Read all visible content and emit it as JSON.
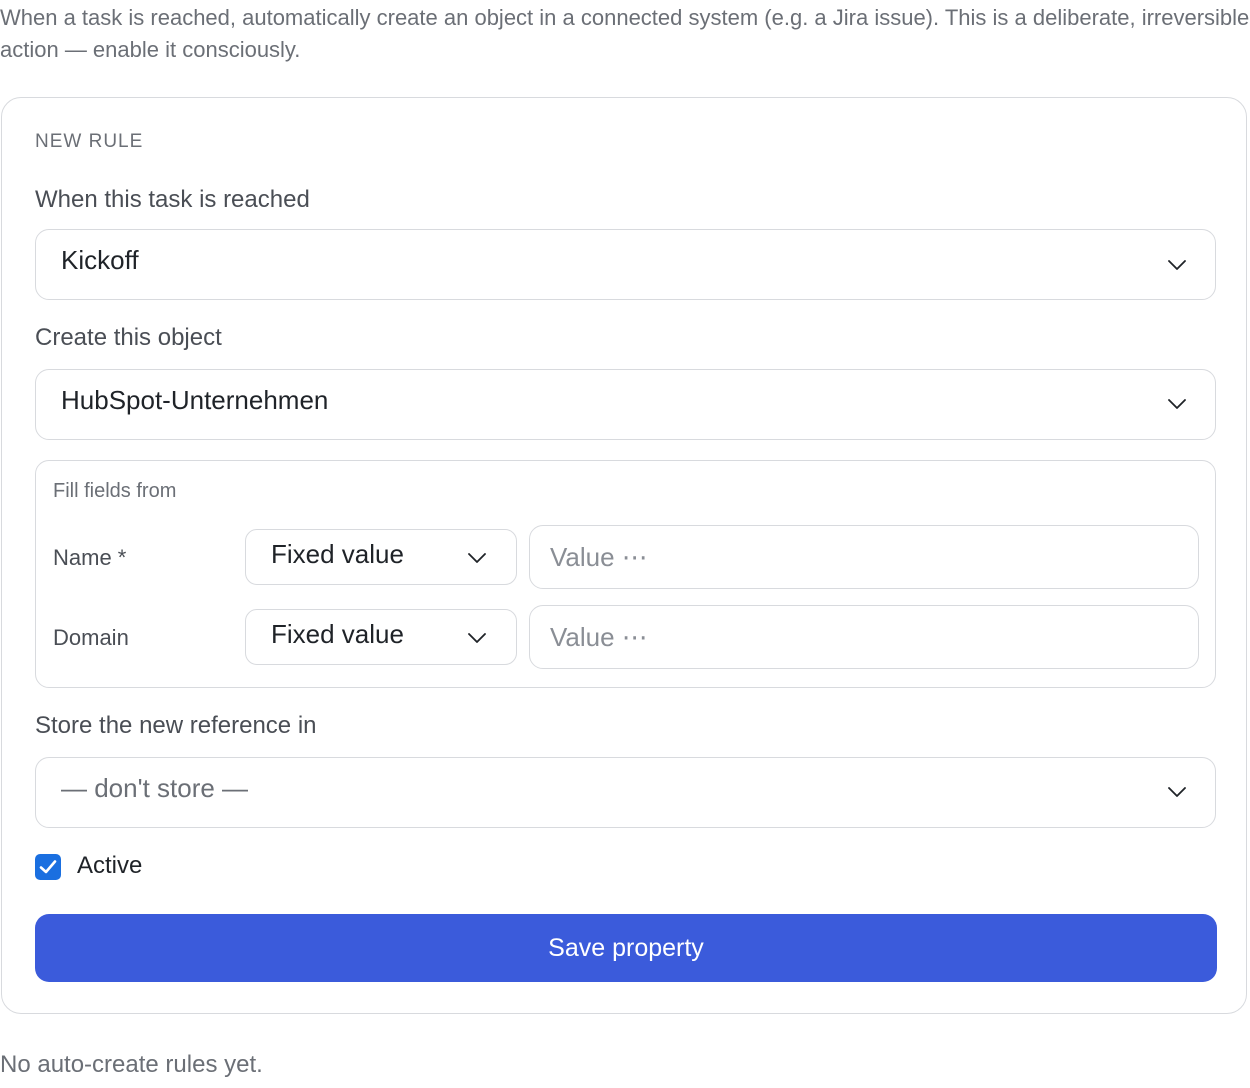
{
  "intro": {
    "text": "When a task is reached, automatically create an object in a connected system (e.g. a Jira issue). This is a deliberate, irreversible action — enable it consciously."
  },
  "rule_form": {
    "section_label": "NEW RULE",
    "task_field": {
      "label": "When this task is reached",
      "selected": "Kickoff"
    },
    "object_field": {
      "label": "Create this object",
      "selected": "HubSpot-Unternehmen"
    },
    "fill_fields": {
      "title": "Fill fields from",
      "rows": [
        {
          "label": "Name *",
          "source": "Fixed value",
          "placeholder": "Value ⋯",
          "value": ""
        },
        {
          "label": "Domain",
          "source": "Fixed value",
          "placeholder": "Value ⋯",
          "value": ""
        }
      ]
    },
    "store_field": {
      "label": "Store the new reference in",
      "selected": "— don't store —"
    },
    "active": {
      "label": "Active",
      "checked": true
    },
    "save_label": "Save property"
  },
  "empty_state": "No auto-create rules yet.",
  "colors": {
    "accent": "#3b5bdb",
    "checkbox": "#1a6fe0",
    "border": "#d8dade",
    "muted_text": "#6b6f76"
  },
  "icons": {
    "dropdown": "chevron-down-icon",
    "checkbox": "check-icon"
  }
}
